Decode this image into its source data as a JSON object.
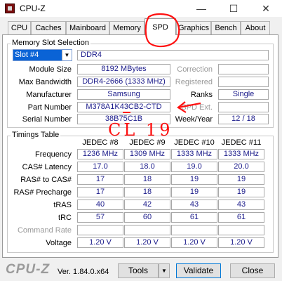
{
  "window": {
    "title": "CPU-Z",
    "minimize": "—",
    "maximize": "☐",
    "close": "✕"
  },
  "tabs": [
    "CPU",
    "Caches",
    "Mainboard",
    "Memory",
    "SPD",
    "Graphics",
    "Bench",
    "About"
  ],
  "memory_slot": {
    "group_title": "Memory Slot Selection",
    "slot_value": "Slot #4",
    "type_value": "DDR4",
    "rows": [
      {
        "label": "Module Size",
        "value": "8192 MBytes",
        "right_label": "Correction",
        "right_value": ""
      },
      {
        "label": "Max Bandwidth",
        "value": "DDR4-2666 (1333 MHz)",
        "right_label": "Registered",
        "right_value": ""
      },
      {
        "label": "Manufacturer",
        "value": "Samsung",
        "right_label": "Ranks",
        "right_value": "Single"
      },
      {
        "label": "Part Number",
        "value": "M378A1K43CB2-CTD",
        "right_label": "SPD Ext.",
        "right_value": ""
      },
      {
        "label": "Serial Number",
        "value": "38B75C1B",
        "right_label": "Week/Year",
        "right_value": "12 / 18"
      }
    ]
  },
  "timings": {
    "group_title": "Timings Table",
    "columns": [
      "JEDEC #8",
      "JEDEC #9",
      "JEDEC #10",
      "JEDEC #11"
    ],
    "rows": [
      {
        "label": "Frequency",
        "values": [
          "1236 MHz",
          "1309 MHz",
          "1333 MHz",
          "1333 MHz"
        ]
      },
      {
        "label": "CAS# Latency",
        "values": [
          "17.0",
          "18.0",
          "19.0",
          "20.0"
        ]
      },
      {
        "label": "RAS# to CAS#",
        "values": [
          "17",
          "18",
          "19",
          "19"
        ]
      },
      {
        "label": "RAS# Precharge",
        "values": [
          "17",
          "18",
          "19",
          "19"
        ]
      },
      {
        "label": "tRAS",
        "values": [
          "40",
          "42",
          "43",
          "43"
        ]
      },
      {
        "label": "tRC",
        "values": [
          "57",
          "60",
          "61",
          "61"
        ]
      },
      {
        "label": "Command Rate",
        "values": [
          "",
          "",
          "",
          ""
        ]
      },
      {
        "label": "Voltage",
        "values": [
          "1.20 V",
          "1.20 V",
          "1.20 V",
          "1.20 V"
        ]
      }
    ]
  },
  "footer": {
    "brand": "CPU-Z",
    "version": "Ver. 1.84.0.x64",
    "tools_label": "Tools",
    "validate_label": "Validate",
    "close_label": "Close"
  },
  "annotation": {
    "handwriting": "CL 19"
  }
}
